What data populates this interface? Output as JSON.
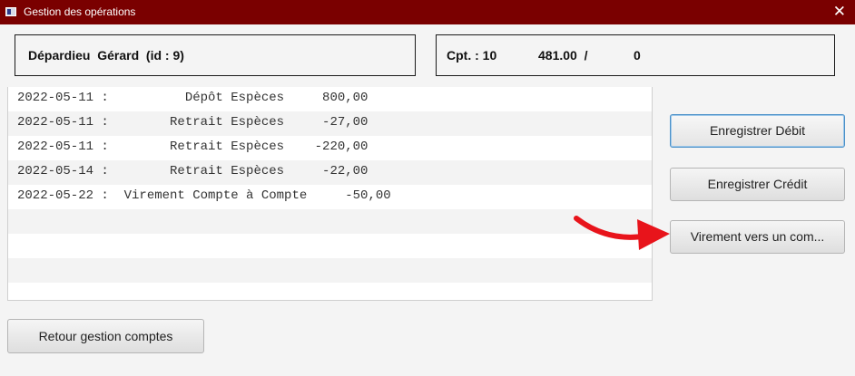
{
  "window": {
    "title": "Gestion des opérations",
    "close_glyph": "✕"
  },
  "client": {
    "label": "Dépardieu  Gérard  (id : 9)"
  },
  "account": {
    "number": "Cpt. : 10",
    "balance": "481.00  /",
    "overdraft": "0"
  },
  "operations": [
    {
      "text": "2022-05-11 :          Dépôt Espèces     800,00"
    },
    {
      "text": "2022-05-11 :        Retrait Espèces     -27,00"
    },
    {
      "text": "2022-05-11 :        Retrait Espèces    -220,00"
    },
    {
      "text": "2022-05-14 :        Retrait Espèces     -22,00"
    },
    {
      "text": "2022-05-22 :  Virement Compte à Compte     -50,00"
    }
  ],
  "buttons": {
    "debit": "Enregistrer Débit",
    "credit": "Enregistrer Crédit",
    "virement": "Virement vers un com...",
    "retour": "Retour gestion comptes"
  },
  "colors": {
    "titlebar": "#7a0000",
    "annotation_arrow": "#e8141b",
    "focus_border": "#4a90c8"
  },
  "icons": {
    "app": "window-app-icon",
    "close": "close-icon",
    "annotation": "red-arrow-icon"
  }
}
